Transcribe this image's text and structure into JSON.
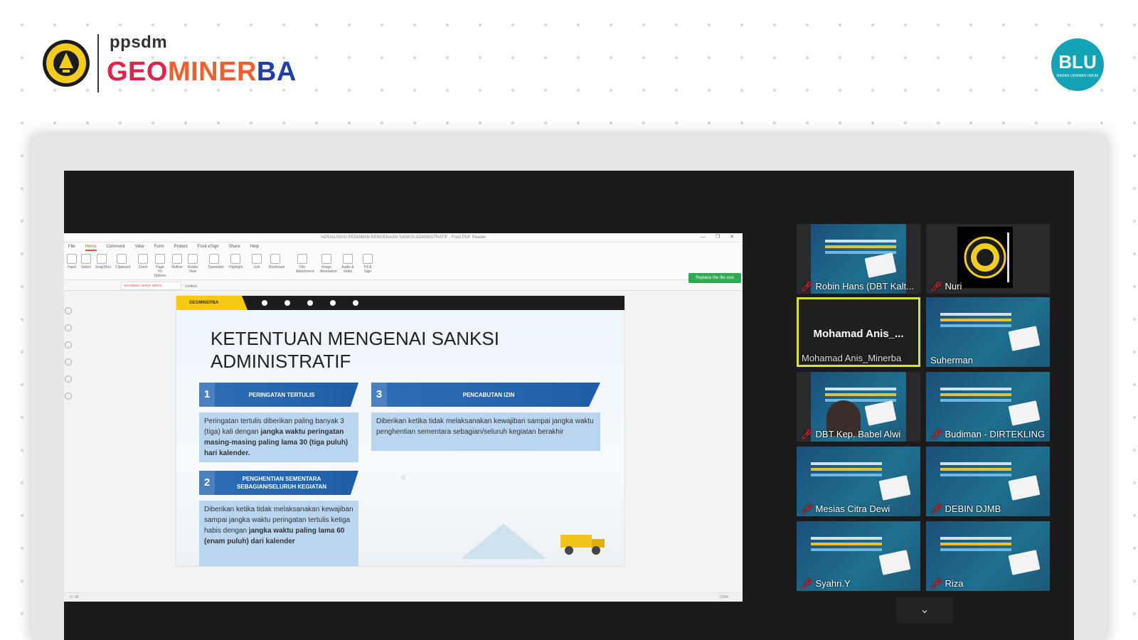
{
  "header": {
    "brand_small": "ppsdm",
    "brand_geo": "GEO",
    "brand_miner": "MINER",
    "brand_ba": "BA",
    "seal_text": "KEMENTERIAN ENERGI DAN SUMBER DAYA MINERAL",
    "blu_label": "BLU",
    "blu_sub": "BADAN LAYANAN UMUM"
  },
  "reader": {
    "window_title": "SOSIALISASI PEDOMAN PENGENAAN SANKSI ADMINISTRATIF - Foxit PDF Reader",
    "tabs": [
      "File",
      "Home",
      "Comment",
      "View",
      "Form",
      "Protect",
      "Foxit eSign",
      "Share",
      "Help"
    ],
    "active_tab": "Home",
    "tools": [
      "Hand",
      "Select",
      "SnapShot",
      "Clipboard",
      "Zoom",
      "Page Fit Options",
      "Reflow",
      "Rotate View",
      "Typewriter",
      "Highlight",
      "Link",
      "Bookmark",
      "File Attachment",
      "Image Annotation",
      "Audio & Video",
      "Fill & Sign"
    ],
    "doc_tab": "sosialisasi sanksi admin",
    "doc_tab2": "Untitled",
    "share_button": "Replace the file size",
    "page_indicator": "5 / 18",
    "zoom_level": "100%"
  },
  "slide": {
    "brand": "GEOMINERBA",
    "title": "KETENTUAN MENGENAI SANKSI ADMINISTRATIF",
    "items": [
      {
        "num": "1",
        "label": "PERINGATAN TERTULIS",
        "desc_plain": "Peringatan tertulis diberikan paling banyak 3 (tiga) kali dengan ",
        "desc_bold": "jangka waktu peringatan masing-masing paling lama 30 (tiga puluh) hari kalender."
      },
      {
        "num": "2",
        "label": "PENGHENTIAN SEMENTARA SEBAGIAN/SELURUH KEGIATAN",
        "desc_plain": "Diberikan ketika tidak melaksanakan kewajiban sampai jangka waktu peringatan tertulis ketiga habis dengan ",
        "desc_bold": "jangka waktu paling lama 60 (enam puluh) dari kalender"
      },
      {
        "num": "3",
        "label": "PENCABUTAN IZIN",
        "desc_plain": "Diberikan ketika tidak melaksanakan kewajiban sampai jangka waktu penghentian sementara sebagian/seluruh kegiatan berakhir",
        "desc_bold": ""
      }
    ]
  },
  "participants": [
    {
      "name": "Robin Hans (DBT Kalt...",
      "type": "presentation"
    },
    {
      "name": "Nuri",
      "type": "seal"
    },
    {
      "name": "Mohamad Anis_Minerba",
      "display": "Mohamad Anis_...",
      "type": "active"
    },
    {
      "name": "Suherman",
      "type": "presentation"
    },
    {
      "name": "DBT Kep. Babel Alwi",
      "type": "face"
    },
    {
      "name": "Budiman - DIRTEKLING",
      "type": "presentation"
    },
    {
      "name": "Mesias Citra Dewi",
      "type": "presentation"
    },
    {
      "name": "DEBIN DJMB",
      "type": "presentation"
    },
    {
      "name": "Syahri.Y",
      "type": "presentation"
    },
    {
      "name": "Riza",
      "type": "presentation"
    }
  ],
  "colors": {
    "geo": "#e0234b",
    "miner": "#f0602e",
    "ba": "#1f3ea8",
    "blu": "#12a4b4",
    "active_speaker": "#d6e23a"
  }
}
